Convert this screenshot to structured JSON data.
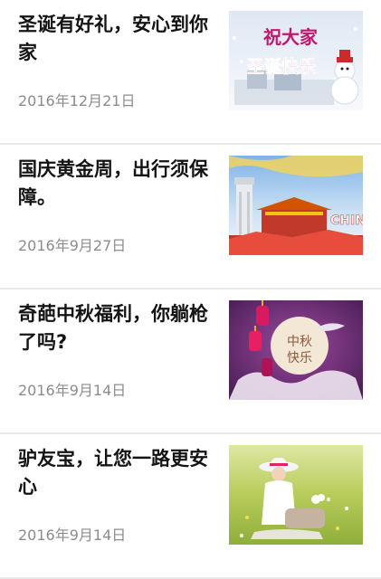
{
  "articles": [
    {
      "title": "圣诞有好礼，安心到你家",
      "date": "2016年12月21日",
      "thumb": {
        "icon": "christmas-greeting-image",
        "text1": "祝大家",
        "text2": "圣诞快乐"
      }
    },
    {
      "title": "国庆黄金周，出行须保障。",
      "date": "2016年9月27日",
      "thumb": {
        "icon": "national-day-image",
        "text1": "CHIN"
      }
    },
    {
      "title": "奇葩中秋福利，你躺枪了吗?",
      "date": "2016年9月14日",
      "thumb": {
        "icon": "mid-autumn-image",
        "text1": "中秋",
        "text2": "快乐"
      }
    },
    {
      "title": "驴友宝，让您一路更安心",
      "date": "2016年9月14日",
      "thumb": {
        "icon": "travel-girl-image"
      }
    }
  ]
}
